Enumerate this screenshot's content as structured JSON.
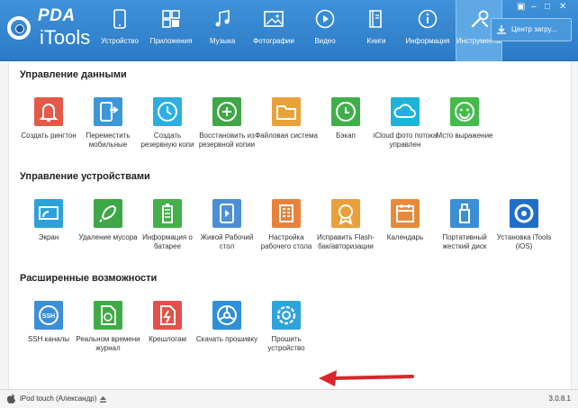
{
  "app": {
    "brand_pda": "PDA",
    "brand_itools": "iTools",
    "window_controls": [
      "▣",
      "–",
      "□",
      "✕"
    ]
  },
  "nav": {
    "items": [
      {
        "label": "Устройство",
        "icon": "device-icon"
      },
      {
        "label": "Приложения",
        "icon": "apps-icon"
      },
      {
        "label": "Музыка",
        "icon": "music-icon"
      },
      {
        "label": "Фотографии",
        "icon": "photos-icon"
      },
      {
        "label": "Видео",
        "icon": "video-icon"
      },
      {
        "label": "Книги",
        "icon": "books-icon"
      },
      {
        "label": "Информация",
        "icon": "info-icon"
      },
      {
        "label": "Инструменты",
        "icon": "tools-icon",
        "active": true
      }
    ],
    "download_label": "Центр загру..."
  },
  "sections": [
    {
      "title": "Управление данными",
      "tiles": [
        {
          "label": "Создать рингтон",
          "color": "#e25a4a",
          "icon": "bell-icon"
        },
        {
          "label": "Переместить мобильные",
          "color": "#3c96d8",
          "icon": "transfer-icon"
        },
        {
          "label": "Создать резервную копи",
          "color": "#2eaee0",
          "icon": "clock-icon"
        },
        {
          "label": "Восстановить из резервной копии",
          "color": "#3da845",
          "icon": "restore-icon"
        },
        {
          "label": "Файловая система",
          "color": "#e9a23b",
          "icon": "folder-icon"
        },
        {
          "label": "Бэкап",
          "color": "#3fb049",
          "icon": "backup-icon"
        },
        {
          "label": "iCloud фото потока управлен",
          "color": "#1fb3d9",
          "icon": "cloud-icon"
        },
        {
          "label": "Мсто выражение",
          "color": "#44bb4a",
          "icon": "smile-icon"
        }
      ]
    },
    {
      "title": "Управление устройствами",
      "tiles": [
        {
          "label": "Экран",
          "color": "#2ba3d8",
          "icon": "screen-icon"
        },
        {
          "label": "Удаление мусора",
          "color": "#3da845",
          "icon": "rocket-icon"
        },
        {
          "label": "Информация о батарее",
          "color": "#43b04a",
          "icon": "battery-icon"
        },
        {
          "label": "Живой Рабочий стол",
          "color": "#4d8fd6",
          "icon": "live-icon"
        },
        {
          "label": "Настройка рабочего стола",
          "color": "#e8823a",
          "icon": "grid-icon"
        },
        {
          "label": "Исправить Flash-бак/авторизации",
          "color": "#e9a03b",
          "icon": "badge-icon"
        },
        {
          "label": "Календарь",
          "color": "#e98a3a",
          "icon": "calendar-icon"
        },
        {
          "label": "Портативный жесткий диск",
          "color": "#3c8fd6",
          "icon": "usb-icon"
        },
        {
          "label": "Установка iTools (iOS)",
          "color": "#1f6fc8",
          "icon": "itools-icon"
        }
      ]
    },
    {
      "title": "Расширенные возможности",
      "tiles": [
        {
          "label": "SSH каналы",
          "color": "#3b8fd8",
          "icon": "ssh-icon",
          "icon_text": "SSH"
        },
        {
          "label": "Реальном времени журнал",
          "color": "#3fab46",
          "icon": "log-icon"
        },
        {
          "label": "Крешлогам",
          "color": "#e2514a",
          "icon": "crash-icon"
        },
        {
          "label": "Скачать прошивку",
          "color": "#2f8fd8",
          "icon": "firmware-download-icon"
        },
        {
          "label": "Прошить устройство",
          "color": "#2fa3dc",
          "icon": "flash-device-icon"
        }
      ]
    }
  ],
  "status": {
    "device": "iPod touch (Александр)",
    "version": "3.0.8.1"
  }
}
